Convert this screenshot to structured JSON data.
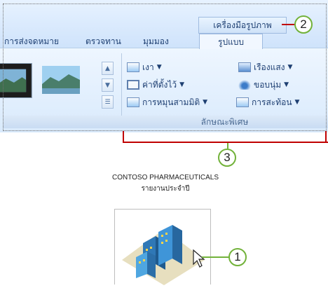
{
  "ribbon": {
    "contextual_tab_group": "เครื่องมือรูปภาพ",
    "tabs": [
      {
        "label": "การส่งจดหมาย"
      },
      {
        "label": "ตรวจทาน"
      },
      {
        "label": "มุมมอง"
      },
      {
        "label": "รูปแบบ",
        "active": true
      }
    ],
    "effects_group": {
      "label": "ลักษณะพิเศษ",
      "commands": [
        {
          "label": "เงา",
          "icon": "shadow-icon"
        },
        {
          "label": "เรืองแสง",
          "icon": "glow-icon"
        },
        {
          "label": "ค่าที่ตั้งไว้",
          "icon": "preset-icon"
        },
        {
          "label": "ขอบนุ่ม",
          "icon": "soft-edges-icon"
        },
        {
          "label": "การหมุนสามมิติ",
          "icon": "3d-rotation-icon"
        },
        {
          "label": "การสะท้อน",
          "icon": "reflection-icon"
        }
      ]
    }
  },
  "callouts": [
    "2",
    "3",
    "1"
  ],
  "document": {
    "company": "CONTOSO PHARMACEUTICALS",
    "subtitle": "รายงานประจำปี"
  },
  "colors": {
    "callout_border": "#72b23a",
    "leader_line": "#c00000",
    "ribbon_text": "#1e3f72"
  }
}
